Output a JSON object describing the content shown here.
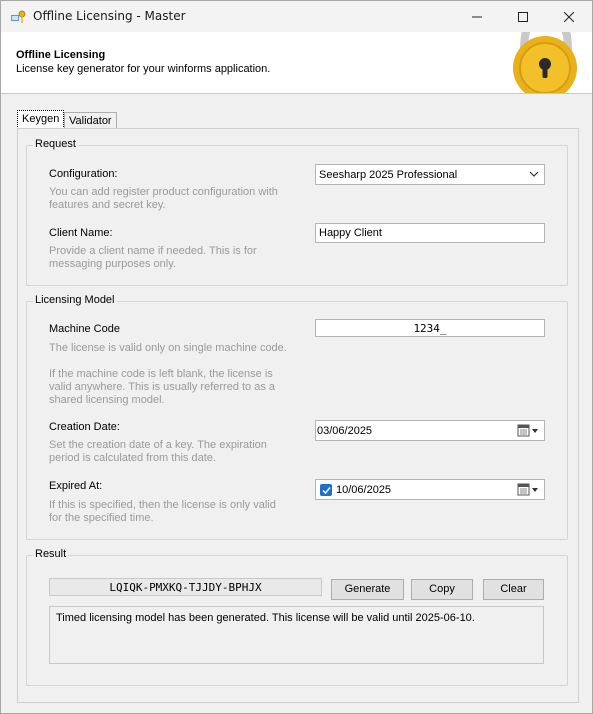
{
  "window": {
    "title": "Offline Licensing - Master"
  },
  "header": {
    "title": "Offline Licensing",
    "subtitle": "License key generator for your winforms application."
  },
  "tabs": [
    {
      "label": "Keygen",
      "active": true
    },
    {
      "label": "Validator",
      "active": false
    }
  ],
  "request": {
    "group_label": "Request",
    "configuration": {
      "label": "Configuration:",
      "description": "You can add register product configuration with features and secret key.",
      "value": "Seesharp 2025 Professional"
    },
    "client_name": {
      "label": "Client Name:",
      "description": "Provide a client name if needed. This is for messaging purposes only.",
      "value": "Happy Client"
    }
  },
  "licensing_model": {
    "group_label": "Licensing Model",
    "machine_code": {
      "label": "Machine Code",
      "description": "The license is valid only on single machine code.",
      "description2": "If the machine code is left blank, the license is valid anywhere. This is usually referred to as a shared licensing model.",
      "value": "1234_"
    },
    "creation_date": {
      "label": "Creation Date:",
      "description": "Set the creation date of a key. The expiration period is calculated from this date.",
      "value": "03/06/2025"
    },
    "expired_at": {
      "label": "Expired At:",
      "description": "If this is specified, then the license is only valid for the specified time.",
      "value": "10/06/2025",
      "checked": true
    }
  },
  "result": {
    "group_label": "Result",
    "license_key": "LQIQK-PMXKQ-TJJDY-BPHJX",
    "generate_label": "Generate",
    "copy_label": "Copy",
    "clear_label": "Clear",
    "message": "Timed licensing model has been generated. This license will be valid until 2025-06-10."
  },
  "colors": {
    "accent": "#1f6fd1",
    "lock_gold": "#e8b019",
    "muted_text": "#9a9a9a"
  }
}
